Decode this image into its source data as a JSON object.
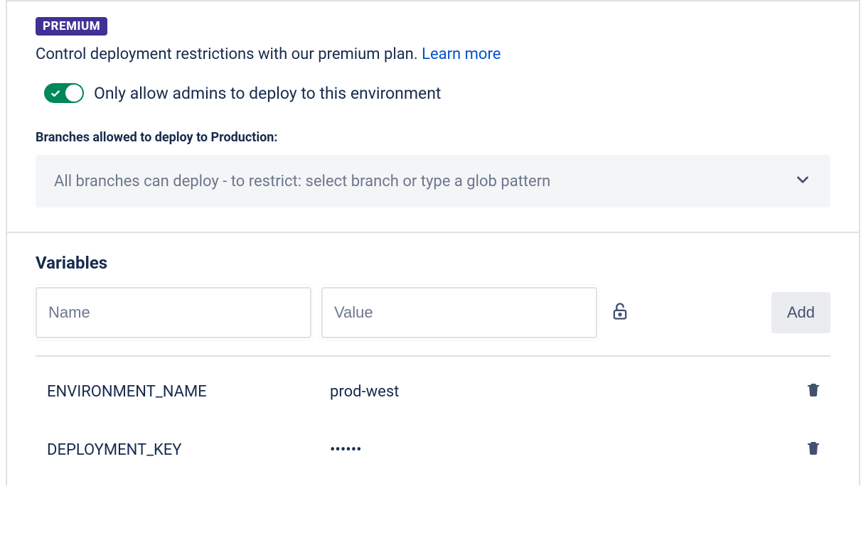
{
  "premium": {
    "badge": "PREMIUM",
    "desc": "Control deployment restrictions with our premium plan. ",
    "learn_more": "Learn more"
  },
  "toggle": {
    "label": "Only allow admins to deploy to this environment"
  },
  "branches": {
    "label": "Branches allowed to deploy to Production:",
    "placeholder": "All branches can deploy - to restrict: select branch or type a glob pattern"
  },
  "variables": {
    "title": "Variables",
    "name_placeholder": "Name",
    "value_placeholder": "Value",
    "add_label": "Add",
    "rows": [
      {
        "name": "ENVIRONMENT_NAME",
        "value": "prod-west"
      },
      {
        "name": "DEPLOYMENT_KEY",
        "value": "••••••"
      }
    ]
  }
}
